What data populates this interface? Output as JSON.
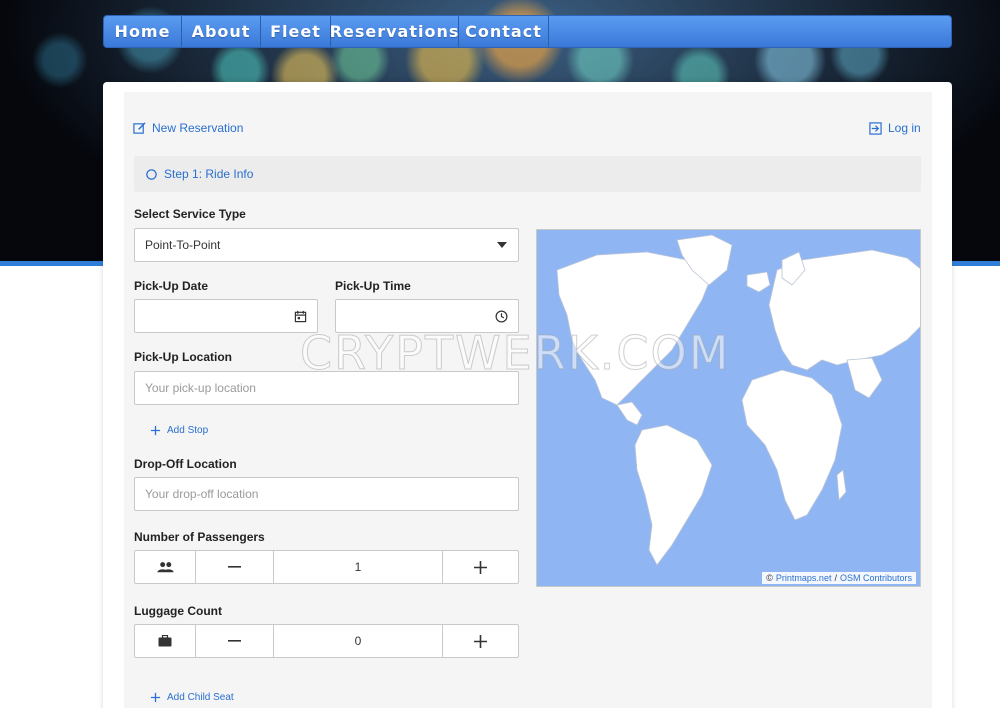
{
  "nav": {
    "items": [
      "Home",
      "About",
      "Fleet",
      "Reservations",
      "Contact"
    ]
  },
  "header": {
    "new_reservation": "New Reservation",
    "login": "Log in"
  },
  "step": {
    "label": "Step 1: Ride Info"
  },
  "service": {
    "label": "Select Service Type",
    "selected": "Point-To-Point"
  },
  "pickup_date": {
    "label": "Pick-Up Date",
    "value": ""
  },
  "pickup_time": {
    "label": "Pick-Up Time",
    "value": ""
  },
  "pickup_location": {
    "label": "Pick-Up Location",
    "placeholder": "Your pick-up location"
  },
  "add_stop": "Add Stop",
  "dropoff_location": {
    "label": "Drop-Off Location",
    "placeholder": "Your drop-off location"
  },
  "passengers": {
    "label": "Number of Passengers",
    "value": "1"
  },
  "luggage": {
    "label": "Luggage Count",
    "value": "0"
  },
  "add_child_seat": "Add Child Seat",
  "map": {
    "credit_prefix": "©",
    "credit_link1": "Printmaps.net",
    "credit_sep": "/",
    "credit_link2": "OSM Contributors"
  },
  "watermark": "CRYPTWERK.COM",
  "colors": {
    "accent": "#2a6fd1",
    "nav": "#4a8be6",
    "ocean": "#8fb6f3",
    "land": "#ffffff"
  },
  "icons": {
    "new_reservation": "edit-icon",
    "login": "login-icon",
    "step": "circle-icon",
    "select": "caret-down-icon",
    "date": "calendar-icon",
    "time": "clock-icon",
    "add": "plus-icon",
    "passengers": "people-icon",
    "luggage": "briefcase-icon",
    "minus": "minus-icon"
  }
}
